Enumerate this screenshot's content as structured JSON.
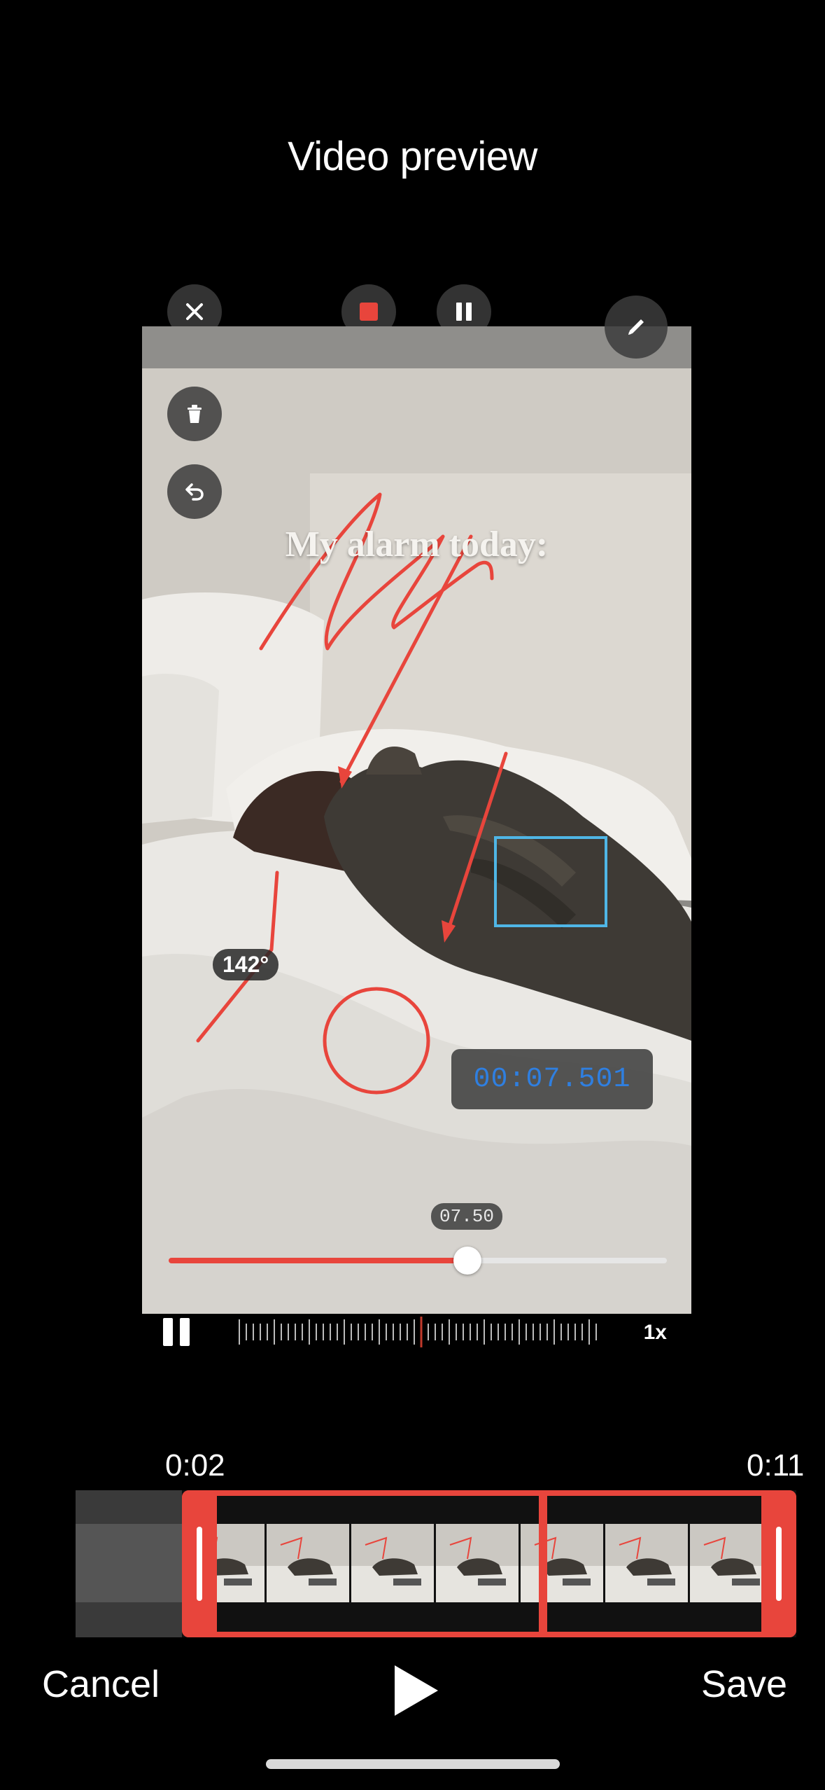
{
  "header": {
    "title": "Video preview"
  },
  "annotation_toolbar": {
    "close_icon": "close-icon",
    "stop_icon": "stop-recording-icon",
    "pause_icon": "pause-icon",
    "pen_icon": "pen-icon",
    "trash_icon": "trash-icon",
    "undo_icon": "undo-icon",
    "stop_color": "#e8453c"
  },
  "video": {
    "overlay_caption": "My alarm today:",
    "angle_label": "142°",
    "timer_readout": "00:07.501",
    "scrub_time": "07.50",
    "scrub_progress": 0.6,
    "annotation_color": "#e8453c",
    "box_color": "#4fb6e6"
  },
  "playback_row": {
    "speed_label": "1x",
    "ruler_marker_color": "#c0392b"
  },
  "trim": {
    "start_label": "0:02",
    "end_label": "0:11",
    "accent_color": "#e8453c"
  },
  "footer": {
    "cancel_label": "Cancel",
    "save_label": "Save",
    "play_icon": "play-icon"
  }
}
